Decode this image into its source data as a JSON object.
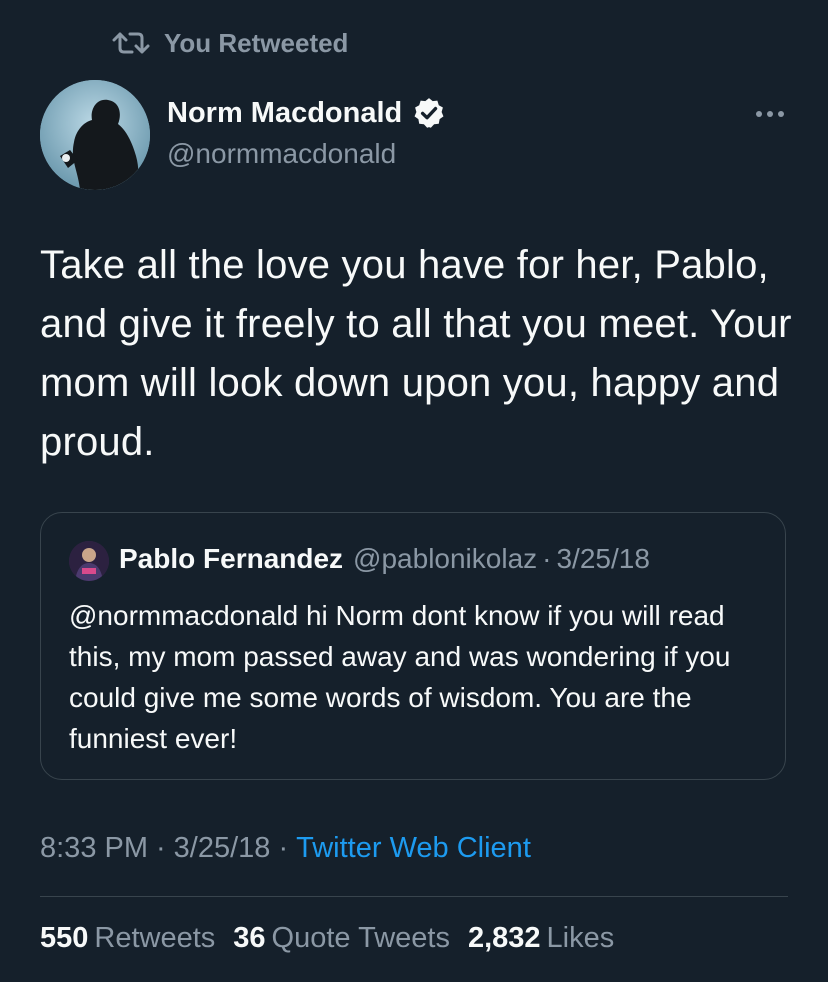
{
  "retweet_banner": {
    "icon": "retweet-icon",
    "label": "You Retweeted"
  },
  "author": {
    "name": "Norm Macdonald",
    "handle": "@normmacdonald",
    "verified": true,
    "avatar": "avatar-silhouette"
  },
  "tweet": {
    "text": "Take all the love you have for her, Pablo, and give it freely to all that you meet. Your mom will look down upon you, happy and proud."
  },
  "quoted_tweet": {
    "name": "Pablo Fernandez",
    "handle": "@pablonikolaz",
    "dot": "·",
    "date": "3/25/18",
    "text": "@normmacdonald hi Norm dont know if you will read this, my mom passed away and was wondering if you could give me some words of wisdom. You are the funniest ever!"
  },
  "meta": {
    "time": "8:33 PM",
    "sep": "·",
    "date": "3/25/18",
    "client": "Twitter Web Client"
  },
  "stats": {
    "retweets_count": "550",
    "retweets_label": "Retweets",
    "quote_count": "36",
    "quote_label": "Quote Tweets",
    "likes_count": "2,832",
    "likes_label": "Likes"
  },
  "colors": {
    "background": "#15202b",
    "primary_text": "#f7f9f9",
    "secondary_text": "#8b98a5",
    "link": "#1d9bf0",
    "border": "#38444d"
  }
}
